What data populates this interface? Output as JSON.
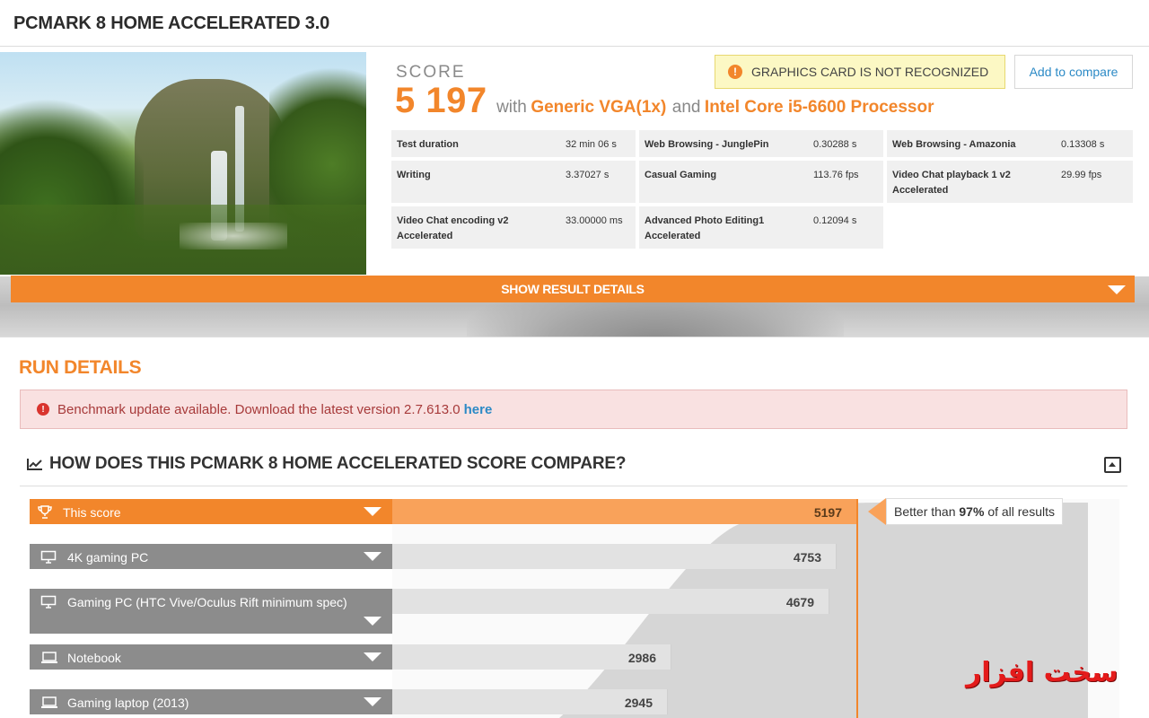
{
  "page_title": "PCMARK 8 HOME ACCELERATED 3.0",
  "score": {
    "label": "SCORE",
    "value": "5 197",
    "with": "with",
    "gpu": "Generic VGA(1x)",
    "and": "and",
    "cpu": "Intel Core i5-6600 Processor"
  },
  "warning": {
    "text": "GRAPHICS CARD IS NOT RECOGNIZED",
    "icon": "!"
  },
  "compare_button": "Add to compare",
  "metrics": [
    {
      "name": "Test duration",
      "value": "32 min 06 s"
    },
    {
      "name": "Web Browsing - JunglePin",
      "value": "0.30288 s"
    },
    {
      "name": "Web Browsing - Amazonia",
      "value": "0.13308 s"
    },
    {
      "name": "Writing",
      "value": "3.37027 s"
    },
    {
      "name": "Casual Gaming",
      "value": "113.76 fps"
    },
    {
      "name": "Video Chat playback 1 v2 Accelerated",
      "value": "29.99 fps"
    },
    {
      "name": "Video Chat encoding v2 Accelerated",
      "value": "33.00000 ms"
    },
    {
      "name": "Advanced Photo Editing1 Accelerated",
      "value": "0.12094 s"
    }
  ],
  "show_details": "SHOW RESULT DETAILS",
  "run_details": {
    "title": "RUN DETAILS",
    "alert_text": "Benchmark update available. Download the latest version 2.7.613.0",
    "alert_link": "here",
    "alert_icon": "!"
  },
  "compare": {
    "title": "HOW DOES THIS PCMARK 8 HOME ACCELERATED SCORE COMPARE?",
    "better_prefix": "Better than",
    "better_percent": "97%",
    "better_suffix": "of all results"
  },
  "comparison_rows": [
    {
      "label": "This score",
      "value": "5197",
      "icon": "trophy-icon",
      "highlight": true
    },
    {
      "label": "4K gaming PC",
      "value": "4753",
      "icon": "monitor-icon",
      "highlight": false
    },
    {
      "label": "Gaming PC (HTC Vive/Oculus Rift minimum spec)",
      "value": "4679",
      "icon": "monitor-icon",
      "highlight": false
    },
    {
      "label": "Notebook",
      "value": "2986",
      "icon": "laptop-icon",
      "highlight": false
    },
    {
      "label": "Gaming laptop (2013)",
      "value": "2945",
      "icon": "laptop-icon",
      "highlight": false
    }
  ],
  "watermark": "سخت افزار",
  "colors": {
    "accent": "#f2862b",
    "this_score_bar": "#f9a25a",
    "row_label_gray": "#8c8c8c",
    "link": "#2c8ac6"
  }
}
